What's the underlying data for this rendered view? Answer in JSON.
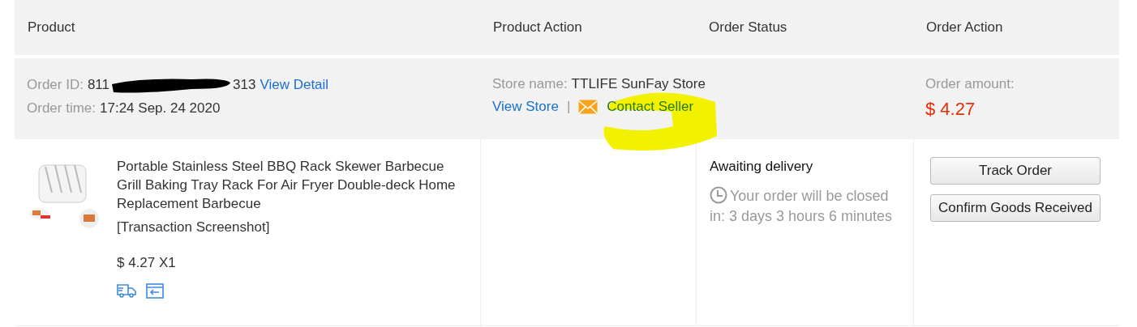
{
  "table": {
    "columns": [
      "Product",
      "Product Action",
      "Order Status",
      "Order Action"
    ]
  },
  "order": {
    "id_label": "Order ID:",
    "id_start": "811",
    "id_end": "313",
    "view_detail": "View Detail",
    "time_label": "Order time:",
    "time": "17:24 Sep. 24 2020",
    "store_label": "Store name:",
    "store": "TTLIFE SunFay Store",
    "view_store": "View Store",
    "separator": "|",
    "contact_seller": "Contact Seller",
    "contact_highlighted": true,
    "amount_label": "Order amount:",
    "amount": "$ 4.27"
  },
  "item": {
    "title": "Portable Stainless Steel BBQ Rack Skewer Barbecue Grill Baking Tray Rack For Air Fryer Double-deck Home Replacement Barbecue",
    "snapshot": "[Transaction Screenshot]",
    "price": "$ 4.27 X1"
  },
  "status": {
    "label": "Awaiting delivery",
    "countdown": "Your order will be closed in: 3 days 3 hours 6 minutes"
  },
  "actions": [
    "Track Order",
    "Confirm Goods Received"
  ]
}
